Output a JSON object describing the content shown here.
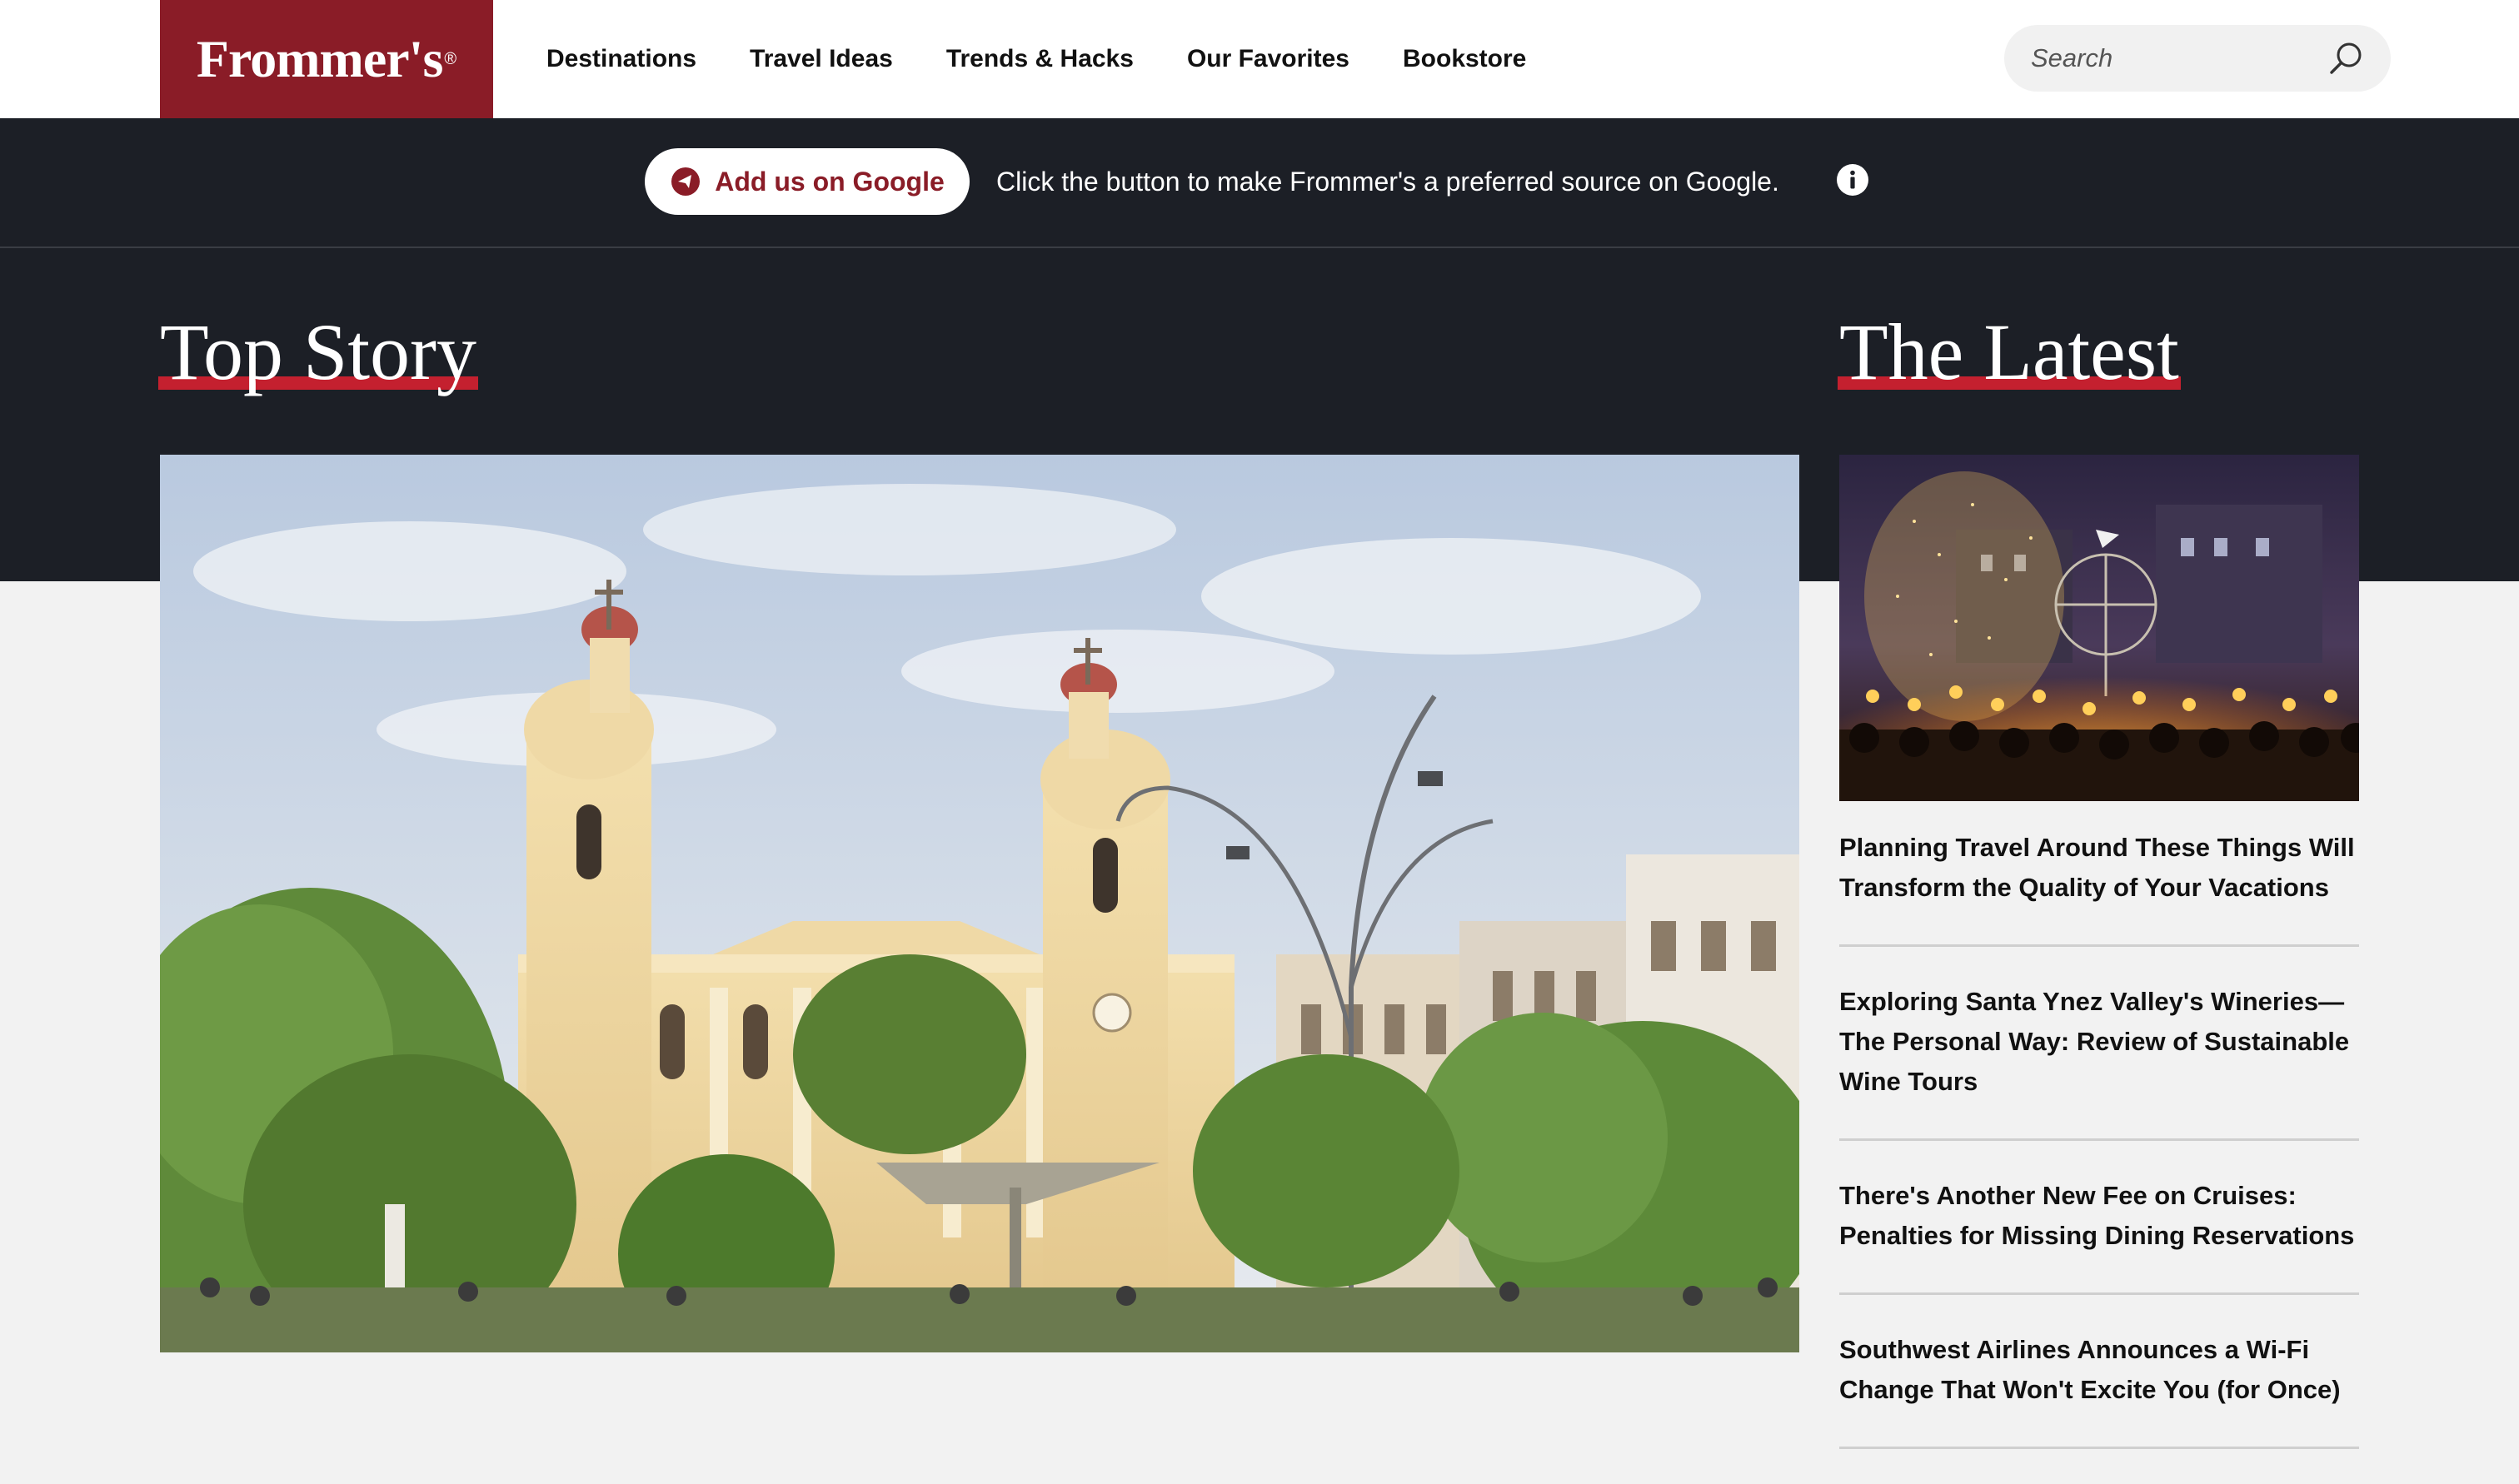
{
  "brand": {
    "name": "Frommer's",
    "reg": "®",
    "color": "#8a1c27"
  },
  "nav": {
    "items": [
      {
        "label": "Destinations"
      },
      {
        "label": "Travel Ideas"
      },
      {
        "label": "Trends & Hacks"
      },
      {
        "label": "Our Favorites"
      },
      {
        "label": "Bookstore"
      }
    ]
  },
  "search": {
    "placeholder": "Search",
    "icon": "search-icon"
  },
  "promo": {
    "button_label": "Add us on Google",
    "text": "Click the button to make Frommer's a preferred source on Google.",
    "icon": "info-icon"
  },
  "sections": {
    "top_story": "Top Story",
    "latest": "The Latest"
  },
  "top_story": {
    "image": "cathedral-plaza-photo"
  },
  "latest": {
    "image": "torch-festival-photo",
    "items": [
      {
        "title": "Planning Travel Around These Things Will Transform the Quality of Your Vacations"
      },
      {
        "title": "Exploring Santa Ynez Valley's Wineries—The Personal Way: Review of Sustainable Wine Tours"
      },
      {
        "title": "There's Another New Fee on Cruises: Penalties for Missing Dining Reservations"
      },
      {
        "title": "Southwest Airlines Announces a Wi-Fi Change That Won't Excite You (for Once)"
      }
    ]
  },
  "colors": {
    "dark_band": "#1c1f26",
    "highlight": "#c4202f"
  }
}
